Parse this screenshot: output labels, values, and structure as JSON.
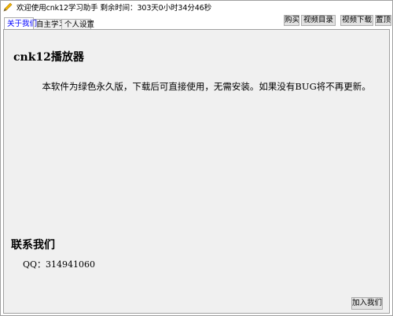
{
  "window": {
    "title": "欢迎使用cnk12学习助手 剩余时间：303天0小时34分46秒"
  },
  "tabs": [
    {
      "label": "关于我们",
      "active": true
    },
    {
      "label": "自主学习",
      "active": false
    },
    {
      "label": "个人设置",
      "active": false
    }
  ],
  "toolbar": {
    "buy_label": "购买",
    "video_catalog_label": "视频目录",
    "video_download_label": "视频下载",
    "fourth_label": "置顶"
  },
  "about": {
    "app_heading": "cnk12播放器",
    "description": "本软件为绿色永久版，下载后可直接使用，无需安装。如果没有BUG将不再更新。",
    "contact_heading": "联系我们",
    "qq": "QQ：314941060",
    "join_label": "加入我们"
  },
  "colors": {
    "active_tab_text": "#0000ff",
    "panel_bg": "#f0f0f0",
    "button_bg": "#e1e1e1"
  }
}
